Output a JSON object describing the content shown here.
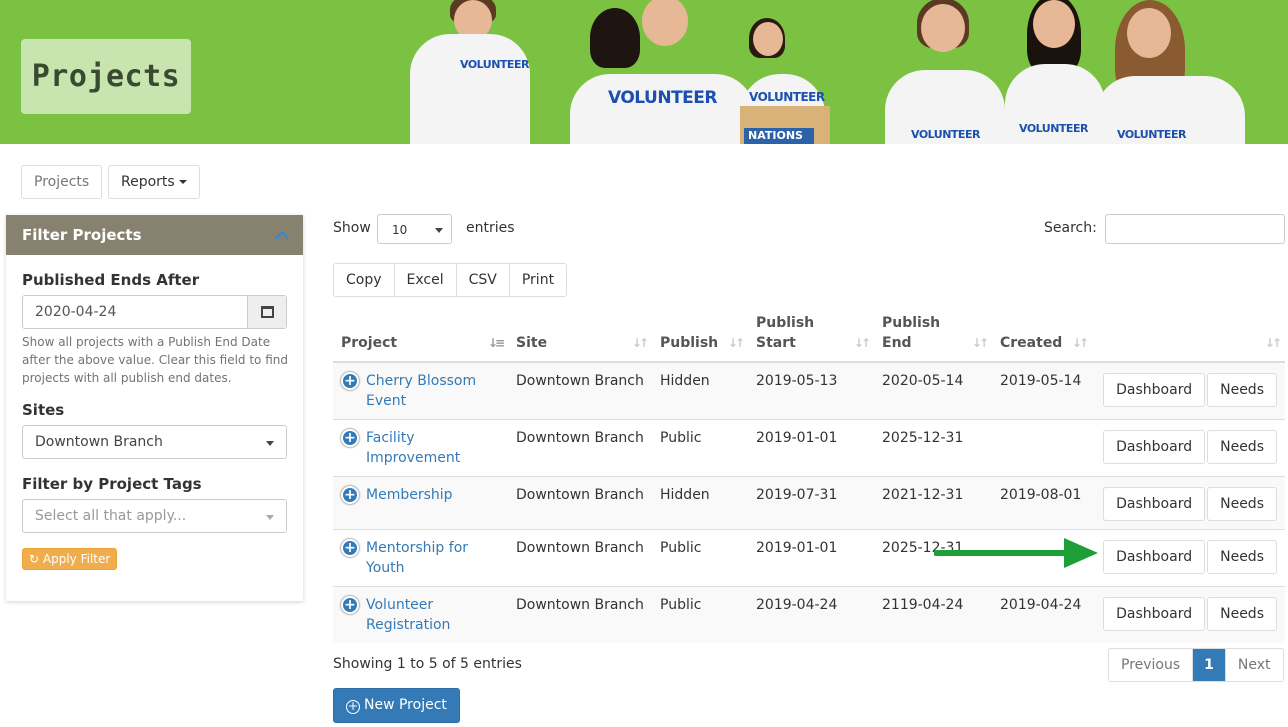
{
  "banner": {
    "title": "Projects",
    "shirt_text": "VOLUNTEER",
    "donations_text": "NATIONS"
  },
  "nav": {
    "projects_label": "Projects",
    "reports_label": "Reports"
  },
  "filter": {
    "header": "Filter Projects",
    "published_ends_label": "Published Ends After",
    "published_ends_value": "2020-04-24",
    "help_text": "Show all projects with a Publish End Date after the above value. Clear this field to find projects with all publish end dates.",
    "sites_label": "Sites",
    "sites_value": "Downtown Branch",
    "tags_label": "Filter by Project Tags",
    "tags_placeholder": "Select all that apply...",
    "apply_label": "Apply Filter"
  },
  "table_controls": {
    "show_label": "Show",
    "entries_value": "10",
    "entries_label": "entries",
    "search_label": "Search:",
    "export_buttons": [
      "Copy",
      "Excel",
      "CSV",
      "Print"
    ]
  },
  "table": {
    "headers": {
      "project": "Project",
      "site": "Site",
      "publish": "Publish",
      "publish_start": "Publish Start",
      "publish_end": "Publish End",
      "created": "Created"
    },
    "rows": [
      {
        "project": "Cherry Blossom Event",
        "site": "Downtown Branch",
        "publish": "Hidden",
        "start": "2019-05-13",
        "end": "2020-05-14",
        "created": "2019-05-14"
      },
      {
        "project": "Facility Improvement",
        "site": "Downtown Branch",
        "publish": "Public",
        "start": "2019-01-01",
        "end": "2025-12-31",
        "created": ""
      },
      {
        "project": "Membership",
        "site": "Downtown Branch",
        "publish": "Hidden",
        "start": "2019-07-31",
        "end": "2021-12-31",
        "created": "2019-08-01"
      },
      {
        "project": "Mentorship for Youth",
        "site": "Downtown Branch",
        "publish": "Public",
        "start": "2019-01-01",
        "end": "2025-12-31",
        "created": ""
      },
      {
        "project": "Volunteer Registration",
        "site": "Downtown Branch",
        "publish": "Public",
        "start": "2019-04-24",
        "end": "2119-04-24",
        "created": "2019-04-24"
      }
    ],
    "dashboard_label": "Dashboard",
    "needs_label": "Needs"
  },
  "footer": {
    "showing_text": "Showing 1 to 5 of 5 entries",
    "previous_label": "Previous",
    "current_page": "1",
    "next_label": "Next",
    "new_project_label": "New Project"
  },
  "colors": {
    "banner_green": "#7cc242",
    "primary_blue": "#337ab7",
    "filter_header": "#86826f",
    "apply_orange": "#f0ad4e",
    "arrow_green": "#1e9e36"
  }
}
